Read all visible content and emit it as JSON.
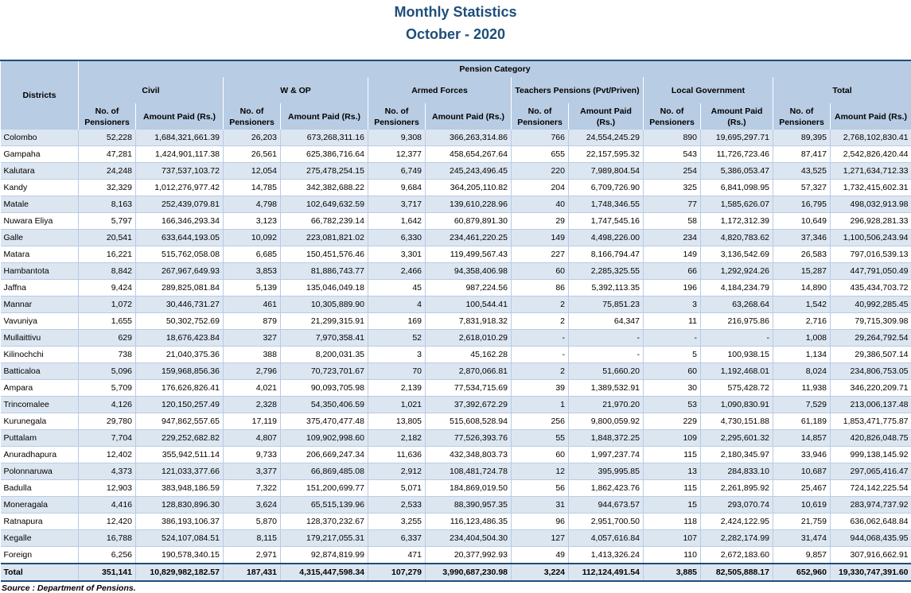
{
  "title": "Monthly Statistics",
  "subtitle": "October - 2020",
  "header": {
    "districts": "Districts",
    "pension_category": "Pension Category",
    "categories": [
      "Civil",
      "W & OP",
      "Armed Forces",
      "Teachers Pensions (Pvt/Priven)",
      "Local Government",
      "Total"
    ],
    "sub": [
      [
        "No. of Pensioners",
        "Amount Paid  (Rs.)"
      ],
      [
        "No. of Pensioners",
        "Amount Paid (Rs.)"
      ],
      [
        "No. of Pensioners",
        "Amount Paid (Rs.)"
      ],
      [
        "No. of Pensioners",
        "Amount Paid (Rs.)"
      ],
      [
        "No. of Pensioners",
        "Amount Paid (Rs.)"
      ],
      [
        "No. of Pensioners",
        "Amount Paid     (Rs.)"
      ]
    ]
  },
  "rows": [
    [
      "Colombo",
      "52,228",
      "1,684,321,661.39",
      "26,203",
      "673,268,311.16",
      "9,308",
      "366,263,314.86",
      "766",
      "24,554,245.29",
      "890",
      "19,695,297.71",
      "89,395",
      "2,768,102,830.41"
    ],
    [
      "Gampaha",
      "47,281",
      "1,424,901,117.38",
      "26,561",
      "625,386,716.64",
      "12,377",
      "458,654,267.64",
      "655",
      "22,157,595.32",
      "543",
      "11,726,723.46",
      "87,417",
      "2,542,826,420.44"
    ],
    [
      "Kalutara",
      "24,248",
      "737,537,103.72",
      "12,054",
      "275,478,254.15",
      "6,749",
      "245,243,496.45",
      "220",
      "7,989,804.54",
      "254",
      "5,386,053.47",
      "43,525",
      "1,271,634,712.33"
    ],
    [
      "Kandy",
      "32,329",
      "1,012,276,977.42",
      "14,785",
      "342,382,688.22",
      "9,684",
      "364,205,110.82",
      "204",
      "6,709,726.90",
      "325",
      "6,841,098.95",
      "57,327",
      "1,732,415,602.31"
    ],
    [
      "Matale",
      "8,163",
      "252,439,079.81",
      "4,798",
      "102,649,632.59",
      "3,717",
      "139,610,228.96",
      "40",
      "1,748,346.55",
      "77",
      "1,585,626.07",
      "16,795",
      "498,032,913.98"
    ],
    [
      "Nuwara Eliya",
      "5,797",
      "166,346,293.34",
      "3,123",
      "66,782,239.14",
      "1,642",
      "60,879,891.30",
      "29",
      "1,747,545.16",
      "58",
      "1,172,312.39",
      "10,649",
      "296,928,281.33"
    ],
    [
      "Galle",
      "20,541",
      "633,644,193.05",
      "10,092",
      "223,081,821.02",
      "6,330",
      "234,461,220.25",
      "149",
      "4,498,226.00",
      "234",
      "4,820,783.62",
      "37,346",
      "1,100,506,243.94"
    ],
    [
      "Matara",
      "16,221",
      "515,762,058.08",
      "6,685",
      "150,451,576.46",
      "3,301",
      "119,499,567.43",
      "227",
      "8,166,794.47",
      "149",
      "3,136,542.69",
      "26,583",
      "797,016,539.13"
    ],
    [
      "Hambantota",
      "8,842",
      "267,967,649.93",
      "3,853",
      "81,886,743.77",
      "2,466",
      "94,358,406.98",
      "60",
      "2,285,325.55",
      "66",
      "1,292,924.26",
      "15,287",
      "447,791,050.49"
    ],
    [
      "Jaffna",
      "9,424",
      "289,825,081.84",
      "5,139",
      "135,046,049.18",
      "45",
      "987,224.56",
      "86",
      "5,392,113.35",
      "196",
      "4,184,234.79",
      "14,890",
      "435,434,703.72"
    ],
    [
      "Mannar",
      "1,072",
      "30,446,731.27",
      "461",
      "10,305,889.90",
      "4",
      "100,544.41",
      "2",
      "75,851.23",
      "3",
      "63,268.64",
      "1,542",
      "40,992,285.45"
    ],
    [
      "Vavuniya",
      "1,655",
      "50,302,752.69",
      "879",
      "21,299,315.91",
      "169",
      "7,831,918.32",
      "2",
      "64,347",
      "11",
      "216,975.86",
      "2,716",
      "79,715,309.98"
    ],
    [
      "Mullaittivu",
      "629",
      "18,676,423.84",
      "327",
      "7,970,358.41",
      "52",
      "2,618,010.29",
      "-",
      "-",
      "-",
      "-",
      "1,008",
      "29,264,792.54"
    ],
    [
      "Kilinochchi",
      "738",
      "21,040,375.36",
      "388",
      "8,200,031.35",
      "3",
      "45,162.28",
      "-",
      "-",
      "5",
      "100,938.15",
      "1,134",
      "29,386,507.14"
    ],
    [
      "Batticaloa",
      "5,096",
      "159,968,856.36",
      "2,796",
      "70,723,701.67",
      "70",
      "2,870,066.81",
      "2",
      "51,660.20",
      "60",
      "1,192,468.01",
      "8,024",
      "234,806,753.05"
    ],
    [
      "Ampara",
      "5,709",
      "176,626,826.41",
      "4,021",
      "90,093,705.98",
      "2,139",
      "77,534,715.69",
      "39",
      "1,389,532.91",
      "30",
      "575,428.72",
      "11,938",
      "346,220,209.71"
    ],
    [
      "Trincomalee",
      "4,126",
      "120,150,257.49",
      "2,328",
      "54,350,406.59",
      "1,021",
      "37,392,672.29",
      "1",
      "21,970.20",
      "53",
      "1,090,830.91",
      "7,529",
      "213,006,137.48"
    ],
    [
      "Kurunegala",
      "29,780",
      "947,862,557.65",
      "17,119",
      "375,470,477.48",
      "13,805",
      "515,608,528.94",
      "256",
      "9,800,059.92",
      "229",
      "4,730,151.88",
      "61,189",
      "1,853,471,775.87"
    ],
    [
      "Puttalam",
      "7,704",
      "229,252,682.82",
      "4,807",
      "109,902,998.60",
      "2,182",
      "77,526,393.76",
      "55",
      "1,848,372.25",
      "109",
      "2,295,601.32",
      "14,857",
      "420,826,048.75"
    ],
    [
      "Anuradhapura",
      "12,402",
      "355,942,511.14",
      "9,733",
      "206,669,247.34",
      "11,636",
      "432,348,803.73",
      "60",
      "1,997,237.74",
      "115",
      "2,180,345.97",
      "33,946",
      "999,138,145.92"
    ],
    [
      "Polonnaruwa",
      "4,373",
      "121,033,377.66",
      "3,377",
      "66,869,485.08",
      "2,912",
      "108,481,724.78",
      "12",
      "395,995.85",
      "13",
      "284,833.10",
      "10,687",
      "297,065,416.47"
    ],
    [
      "Badulla",
      "12,903",
      "383,948,186.59",
      "7,322",
      "151,200,699.77",
      "5,071",
      "184,869,019.50",
      "56",
      "1,862,423.76",
      "115",
      "2,261,895.92",
      "25,467",
      "724,142,225.54"
    ],
    [
      "Moneragala",
      "4,416",
      "128,830,896.30",
      "3,624",
      "65,515,139.96",
      "2,533",
      "88,390,957.35",
      "31",
      "944,673.57",
      "15",
      "293,070.74",
      "10,619",
      "283,974,737.92"
    ],
    [
      "Ratnapura",
      "12,420",
      "386,193,106.37",
      "5,870",
      "128,370,232.67",
      "3,255",
      "116,123,486.35",
      "96",
      "2,951,700.50",
      "118",
      "2,424,122.95",
      "21,759",
      "636,062,648.84"
    ],
    [
      "Kegalle",
      "16,788",
      "524,107,084.51",
      "8,115",
      "179,217,055.31",
      "6,337",
      "234,404,504.30",
      "127",
      "4,057,616.84",
      "107",
      "2,282,174.99",
      "31,474",
      "944,068,435.95"
    ],
    [
      "Foreign",
      "6,256",
      "190,578,340.15",
      "2,971",
      "92,874,819.99",
      "471",
      "20,377,992.93",
      "49",
      "1,413,326.24",
      "110",
      "2,672,183.60",
      "9,857",
      "307,916,662.91"
    ]
  ],
  "total": [
    "Total",
    "351,141",
    "10,829,982,182.57",
    "187,431",
    "4,315,447,598.34",
    "107,279",
    "3,990,687,230.98",
    "3,224",
    "112,124,491.54",
    "3,885",
    "82,505,888.17",
    "652,960",
    "19,330,747,391.60"
  ],
  "source": "Source : Department of Pensions."
}
